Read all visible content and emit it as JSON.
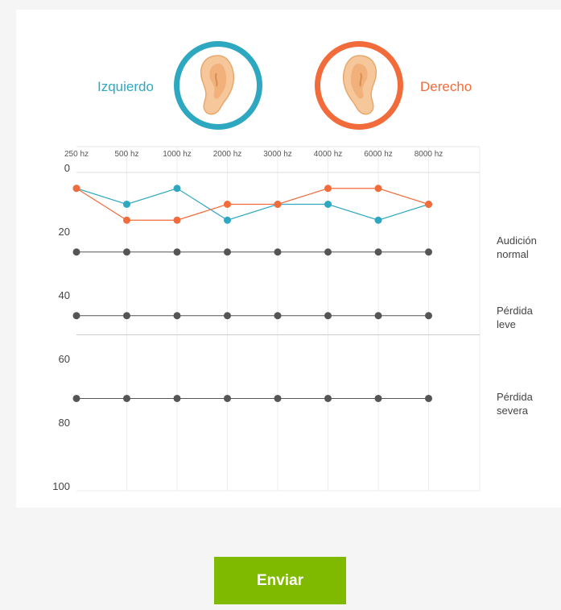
{
  "ears": {
    "left_label": "Izquierdo",
    "right_label": "Derecho",
    "left_color": "#2ea8c0",
    "right_color": "#f26b3a",
    "left_icon": "ear-icon",
    "right_icon": "ear-icon"
  },
  "chart_data": {
    "type": "line",
    "categories": [
      "250 hz",
      "500 hz",
      "1000 hz",
      "2000 hz",
      "3000 hz",
      "4000 hz",
      "6000 hz",
      "8000 hz"
    ],
    "ylim": [
      0,
      100
    ],
    "yticks": [
      0,
      20,
      40,
      60,
      80,
      100
    ],
    "y_inverted": true,
    "x_axis_position": "top",
    "grid": true,
    "series": [
      {
        "name": "Izquierdo",
        "color": "#2ea8c0",
        "values": [
          5,
          10,
          5,
          15,
          10,
          10,
          15,
          10
        ]
      },
      {
        "name": "Derecho",
        "color": "#f26b3a",
        "values": [
          5,
          15,
          15,
          10,
          10,
          5,
          5,
          10
        ]
      }
    ],
    "reference_lines": [
      {
        "label": "Audición normal",
        "value": 25,
        "color": "#555555"
      },
      {
        "label": "Pérdida leve",
        "value": 45,
        "color": "#555555"
      },
      {
        "label": "Pérdida severa",
        "value": 71,
        "color": "#555555"
      }
    ],
    "band_separator": 51
  },
  "submit": {
    "label": "Enviar",
    "color": "#7fba00"
  }
}
